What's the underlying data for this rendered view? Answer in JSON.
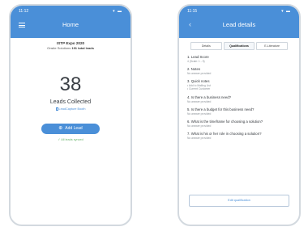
{
  "left_screen": {
    "status_time": "11:12",
    "status_icons": "▾ ▬",
    "title": "Home",
    "event_name": "ISTP Expo 2020",
    "company": "Onsite Solutions",
    "total_leads": "191 total leads",
    "lead_count": "38",
    "leads_label": "Leads Collected",
    "booth_link": "LeadCapture Booth",
    "add_button": "Add Lead",
    "add_button_icon": "plus-icon",
    "synced_text": "✓ All leads synced"
  },
  "right_screen": {
    "status_time": "11:15",
    "status_icons": "▾ ▬",
    "title": "Lead details",
    "tabs": [
      "Details",
      "Qualifications",
      "E-Literature"
    ],
    "active_tab": "Qualifications",
    "questions": [
      {
        "q": "1. Lead Score",
        "a": "4 (Scale: 1 - 5)"
      },
      {
        "q": "2. Notes",
        "a": "No answer provided"
      },
      {
        "q": "3. Quick notes",
        "a": "• Add to Mailing List",
        "a2": "• Current Customer"
      },
      {
        "q": "4. Is there a business need?",
        "a": "No answer provided"
      },
      {
        "q": "5. Is there a budget for this business need?",
        "a": "No answer provided"
      },
      {
        "q": "6. What is the timeframe for choosing a solution?",
        "a": "No answer provided"
      },
      {
        "q": "7. What is his or her role in choosing a solution?",
        "a": "No answer provided"
      }
    ],
    "edit_button": "Edit qualification"
  },
  "colors": {
    "accent": "#4a8fd8",
    "success": "#67b36b",
    "phone_border": "#d3d9df"
  }
}
